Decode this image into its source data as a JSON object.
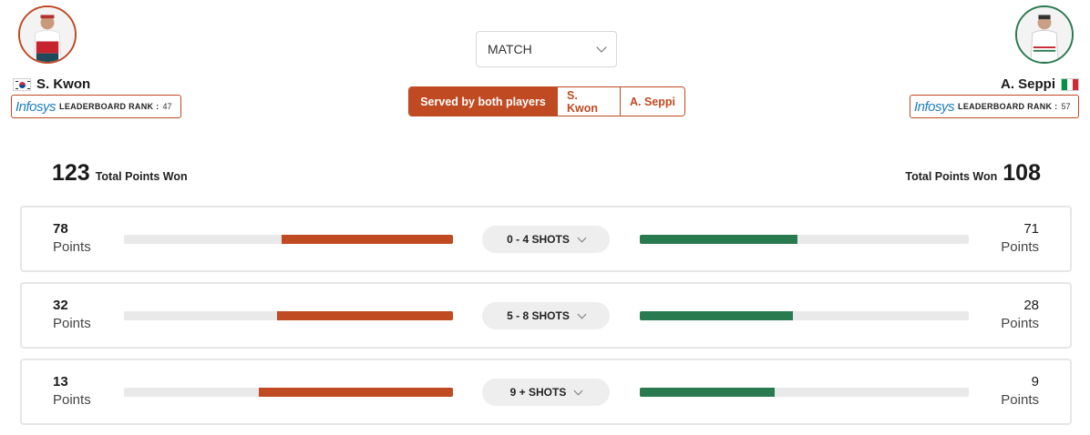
{
  "players": {
    "left": {
      "name": "S. Kwon",
      "flag_icon": "south-korea-flag-icon",
      "color": "#c04a22",
      "rank_brand": "Infosys",
      "rank_label": "LEADERBOARD RANK :",
      "rank": "47",
      "total_points": "123",
      "total_label": "Total Points Won"
    },
    "right": {
      "name": "A. Seppi",
      "flag_icon": "italy-flag-icon",
      "color": "#2a7a50",
      "rank_brand": "Infosys",
      "rank_label": "LEADERBOARD RANK :",
      "rank": "57",
      "total_points": "108",
      "total_label": "Total Points Won"
    }
  },
  "filter": {
    "selected": "MATCH"
  },
  "serve_tabs": [
    {
      "label": "Served by both players",
      "active": true
    },
    {
      "label": "S. Kwon",
      "active": false
    },
    {
      "label": "A. Seppi",
      "active": false
    }
  ],
  "rows": [
    {
      "shots_label": "0 - 4 SHOTS",
      "left_points": "78",
      "right_points": "71",
      "left_fraction": 0.52,
      "right_fraction": 0.48,
      "points_label": "Points"
    },
    {
      "shots_label": "5 - 8 SHOTS",
      "left_points": "32",
      "right_points": "28",
      "left_fraction": 0.535,
      "right_fraction": 0.465,
      "points_label": "Points"
    },
    {
      "shots_label": "9 + SHOTS",
      "left_points": "13",
      "right_points": "9",
      "left_fraction": 0.59,
      "right_fraction": 0.41,
      "points_label": "Points"
    }
  ]
}
